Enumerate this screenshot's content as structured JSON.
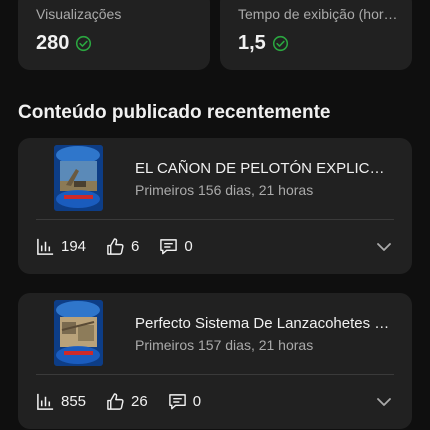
{
  "stats": {
    "views": {
      "label": "Visualizações",
      "value": "280"
    },
    "watch_time": {
      "label": "Tempo de exibição (hor…",
      "value": "1,5"
    }
  },
  "section_title": "Conteúdo publicado recentemente",
  "videos": [
    {
      "title": "EL CAÑON DE PELOTÓN EXPLICAD…",
      "subtitle": "Primeiros 156 dias, 21 horas",
      "views": "194",
      "likes": "6",
      "comments": "0"
    },
    {
      "title": "Perfecto Sistema De Lanzacohetes …",
      "subtitle": "Primeiros 157 dias, 21 horas",
      "views": "855",
      "likes": "26",
      "comments": "0"
    }
  ],
  "colors": {
    "background": "#0f0f0f",
    "card": "#212121",
    "check": "#2ba640",
    "muted_text": "#aaaaaa"
  },
  "icons": [
    "check-circle-icon",
    "bar-chart-icon",
    "thumbs-up-icon",
    "comment-icon",
    "chevron-down-icon"
  ]
}
